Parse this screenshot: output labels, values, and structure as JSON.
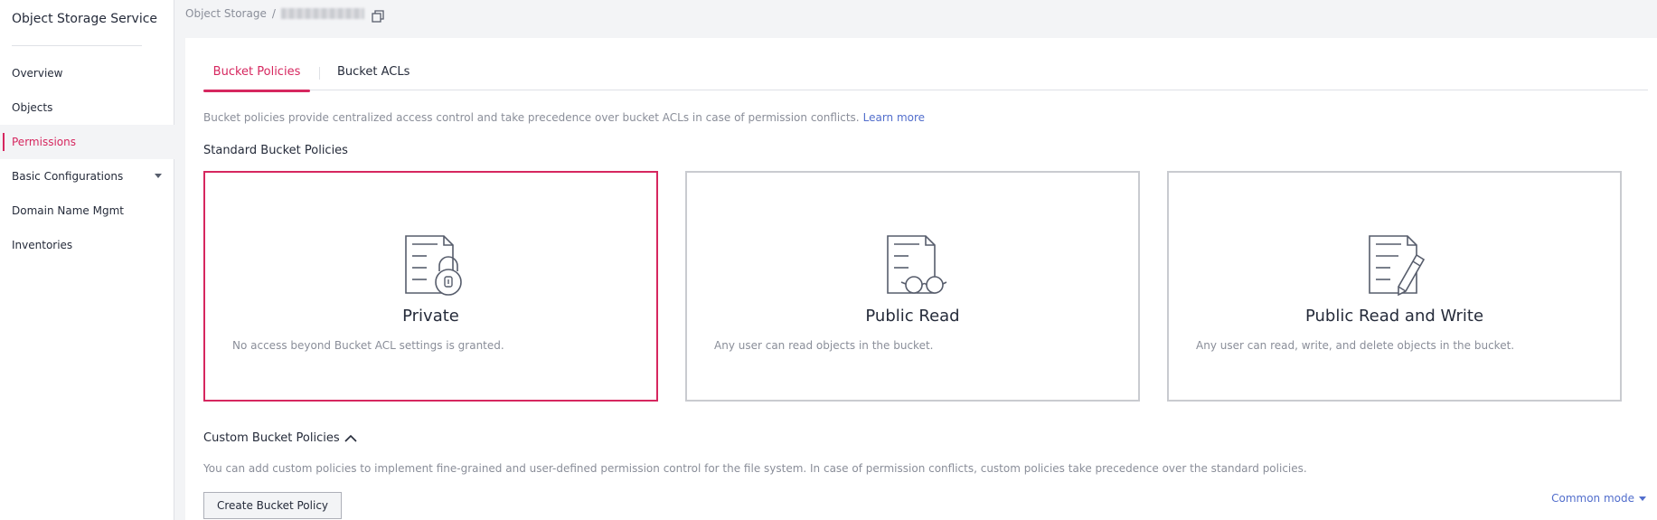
{
  "sidebar": {
    "title": "Object Storage Service",
    "items": [
      {
        "label": "Overview"
      },
      {
        "label": "Objects"
      },
      {
        "label": "Permissions"
      },
      {
        "label": "Basic Configurations"
      },
      {
        "label": "Domain Name Mgmt"
      },
      {
        "label": "Inventories"
      }
    ],
    "active_item": "Permissions"
  },
  "breadcrumb": {
    "root": "Object Storage",
    "separator": "/"
  },
  "tabs": [
    {
      "label": "Bucket Policies",
      "active": true
    },
    {
      "label": "Bucket ACLs",
      "active": false
    }
  ],
  "description": {
    "text": "Bucket policies provide centralized access control and take precedence over bucket ACLs in case of permission conflicts.",
    "link": "Learn more"
  },
  "standard": {
    "title": "Standard Bucket Policies",
    "cards": [
      {
        "title": "Private",
        "desc": "No access beyond Bucket ACL settings is granted.",
        "icon": "document-lock-icon",
        "selected": true
      },
      {
        "title": "Public Read",
        "desc": "Any user can read objects in the bucket.",
        "icon": "document-glasses-icon",
        "selected": false
      },
      {
        "title": "Public Read and Write",
        "desc": "Any user can read, write, and delete objects in the bucket.",
        "icon": "document-pencil-icon",
        "selected": false
      }
    ]
  },
  "custom": {
    "title": "Custom Bucket Policies",
    "desc": "You can add custom policies to implement fine-grained and user-defined permission control for the file system. In case of permission conflicts, custom policies take precedence over the standard policies.",
    "create_button": "Create Bucket Policy"
  },
  "mode": {
    "label": "Common mode"
  },
  "colors": {
    "accent": "#d6275f",
    "link": "#526ecc",
    "text": "#252b3a",
    "muted": "#8a8e99",
    "border": "#c9cbd0"
  }
}
